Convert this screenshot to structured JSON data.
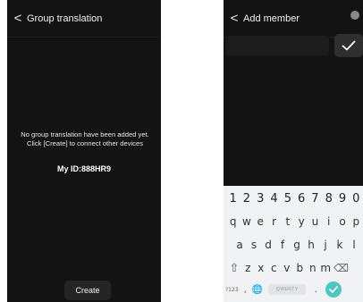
{
  "group_translation": {
    "title": "Group translation",
    "back_glyph": "<",
    "empty_message": "No group translation have been added yet. Click [Create] to connect other devices",
    "my_id": "My ID:888HR9",
    "create_label": "Create"
  },
  "add_member": {
    "title": "Add member",
    "back_glyph": "<",
    "input_value": "",
    "confirm_icon": "check-icon",
    "keyboard": {
      "number_row": [
        "1",
        "2",
        "3",
        "4",
        "5",
        "6",
        "7",
        "8",
        "9",
        "0"
      ],
      "row1": [
        "q",
        "w",
        "e",
        "r",
        "t",
        "y",
        "u",
        "i",
        "o",
        "p"
      ],
      "row2": [
        "a",
        "s",
        "d",
        "f",
        "g",
        "h",
        "j",
        "k",
        "l"
      ],
      "row3": [
        "z",
        "x",
        "c",
        "v",
        "b",
        "n",
        "m"
      ],
      "shift_glyph": "⇧",
      "backspace_glyph": "⌫",
      "symbols_label": "?123",
      "comma": ",",
      "globe_glyph": "🌐",
      "space_label": "QWERTY",
      "period": ".",
      "enter_color": "#4fc7c1"
    }
  }
}
